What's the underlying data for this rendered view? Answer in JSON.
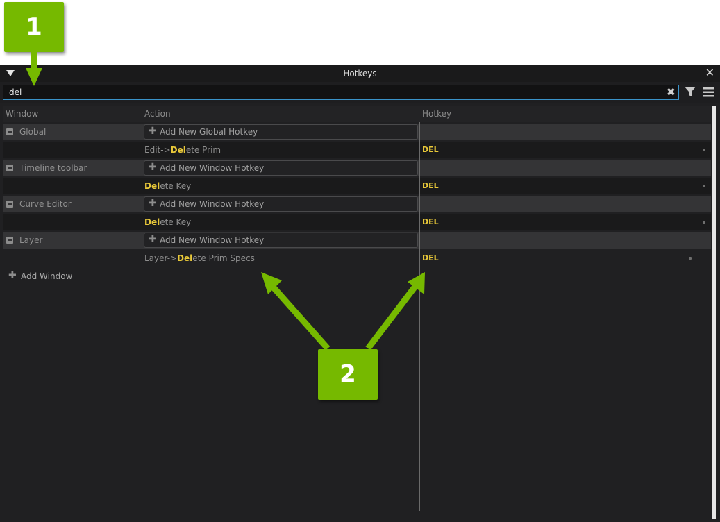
{
  "window": {
    "title": "Hotkeys",
    "close_icon": "close-icon",
    "menu_icon": "triangle-down-icon"
  },
  "search": {
    "value": "del",
    "clear_icon": "clear-x-icon",
    "filter_icon": "filter-icon",
    "options_icon": "hamburger-menu-icon"
  },
  "columns": {
    "window": "Window",
    "action": "Action",
    "hotkey": "Hotkey"
  },
  "groups": [
    {
      "name": "Global",
      "add_label": "Add New Global Hotkey",
      "item": {
        "prefix": "Edit->",
        "match": "Del",
        "suffix": "ete Prim",
        "hotkey": "DEL"
      }
    },
    {
      "name": "Timeline toolbar",
      "add_label": "Add New Window Hotkey",
      "item": {
        "prefix": "",
        "match": "Del",
        "suffix": "ete Key",
        "hotkey": "DEL"
      }
    },
    {
      "name": "Curve Editor",
      "add_label": "Add New Window Hotkey",
      "item": {
        "prefix": "",
        "match": "Del",
        "suffix": "ete Key",
        "hotkey": "DEL"
      }
    },
    {
      "name": "Layer",
      "add_label": "Add New Window Hotkey",
      "item": {
        "prefix": "Layer->",
        "match": "Del",
        "suffix": "ete Prim Specs",
        "hotkey": "DEL"
      }
    }
  ],
  "add_window_label": "Add Window",
  "callouts": {
    "one": "1",
    "two": "2"
  },
  "colors": {
    "accent_green": "#76b900",
    "highlight_yellow": "#e8c839",
    "search_border": "#3a93c9",
    "panel_bg": "#202022"
  }
}
